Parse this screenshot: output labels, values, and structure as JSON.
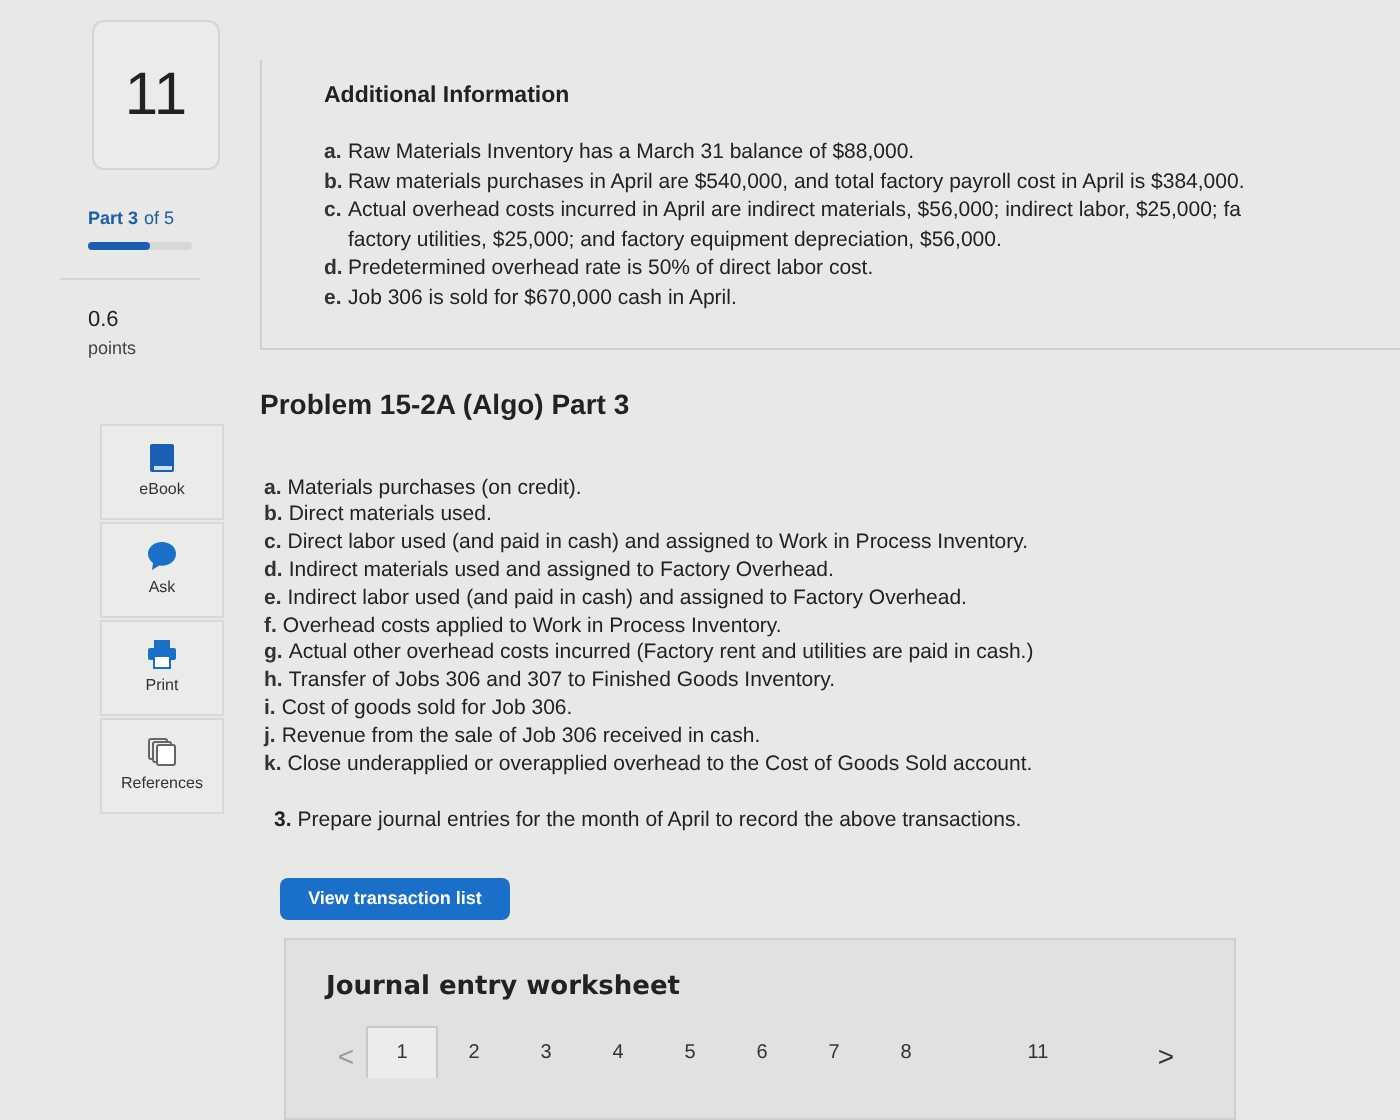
{
  "question": {
    "number": "11",
    "part_label": "Part 3",
    "part_of": "of 5",
    "progress": {
      "level": 0.6
    },
    "points": "0.6",
    "points_label": "points"
  },
  "tools": [
    {
      "kind": "ebook",
      "label": "eBook"
    },
    {
      "kind": "ask",
      "label": "Ask"
    },
    {
      "kind": "print",
      "label": "Print"
    },
    {
      "kind": "references",
      "label": "References"
    }
  ],
  "additional_info": {
    "title": "Additional Information",
    "items": [
      {
        "letter": "a.",
        "lines": [
          "Raw Materials Inventory has a March 31 balance of $88,000."
        ]
      },
      {
        "letter": "b.",
        "lines": [
          "Raw materials purchases in April are $540,000, and total factory payroll cost in April is $384,000."
        ]
      },
      {
        "letter": "c.",
        "lines": [
          "Actual overhead costs incurred in April are indirect materials, $56,000; indirect labor, $25,000; fa",
          "factory utilities, $25,000; and factory equipment depreciation, $56,000."
        ]
      },
      {
        "letter": "d.",
        "lines": [
          "Predetermined overhead rate is 50% of direct labor cost."
        ]
      },
      {
        "letter": "e.",
        "lines": [
          "Job 306 is sold for $670,000 cash in April."
        ]
      }
    ]
  },
  "problem": {
    "title": "Problem 15-2A (Algo) Part 3",
    "items": [
      {
        "letter": "a.",
        "text": "Materials purchases (on credit)."
      },
      {
        "letter": "b.",
        "text": "Direct materials used."
      },
      {
        "letter": "c.",
        "text": "Direct labor used (and paid in cash) and assigned to Work in Process Inventory."
      },
      {
        "letter": "d.",
        "text": "Indirect materials used and assigned to Factory Overhead."
      },
      {
        "letter": "e.",
        "text": "Indirect labor used (and paid in cash) and assigned to Factory Overhead."
      },
      {
        "letter": "f.",
        "text": "Overhead costs applied to Work in Process Inventory."
      },
      {
        "letter": "g.",
        "text": "Actual other overhead costs incurred (Factory rent and utilities are paid in cash.)"
      },
      {
        "letter": "h.",
        "text": "Transfer of Jobs 306 and 307 to Finished Goods Inventory."
      },
      {
        "letter": "i.",
        "text": "Cost of goods sold for Job 306."
      },
      {
        "letter": "j.",
        "text": "Revenue from the sale of Job 306 received in cash."
      },
      {
        "letter": "k.",
        "text": "Close underapplied or overapplied overhead to the Cost of Goods Sold account."
      }
    ],
    "instruction_number": "3.",
    "instruction": "Prepare journal entries for the month of April to record the above transactions."
  },
  "view_button": "View transaction list",
  "worksheet": {
    "title": "Journal entry worksheet",
    "prev": "<",
    "next": ">",
    "tabs": [
      {
        "label": "1",
        "selected": true
      },
      {
        "label": "2",
        "selected": false
      },
      {
        "label": "3",
        "selected": false
      },
      {
        "label": "4",
        "selected": false
      },
      {
        "label": "5",
        "selected": false
      },
      {
        "label": "6",
        "selected": false
      },
      {
        "label": "7",
        "selected": false
      },
      {
        "label": "8",
        "selected": false
      },
      {
        "label": "11",
        "selected": false
      }
    ]
  }
}
